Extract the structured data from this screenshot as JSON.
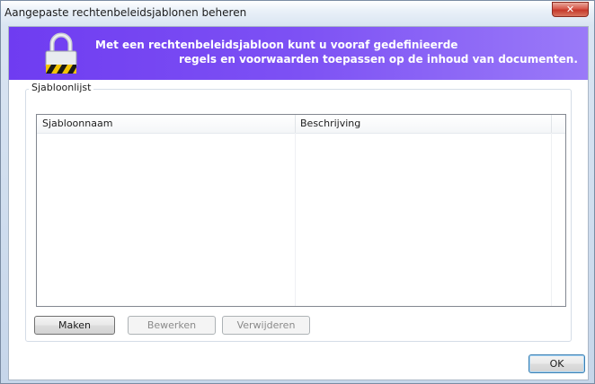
{
  "window": {
    "title": "Aangepaste rechtenbeleidsjablonen beheren",
    "close_symbol": "✕"
  },
  "banner": {
    "line1": "Met een rechtenbeleidsjabloon kunt u vooraf gedefinieerde",
    "line2": "regels en voorwaarden toepassen op de inhoud van documenten.",
    "icon": "padlock-icon",
    "color_start": "#6f3cf1",
    "color_end": "#9a7af8"
  },
  "group": {
    "label": "Sjabloonlijst"
  },
  "list": {
    "columns": [
      "Sjabloonnaam",
      "Beschrijving"
    ],
    "rows": []
  },
  "buttons": {
    "create": "Maken",
    "edit": "Bewerken",
    "delete": "Verwijderen",
    "ok": "OK"
  }
}
